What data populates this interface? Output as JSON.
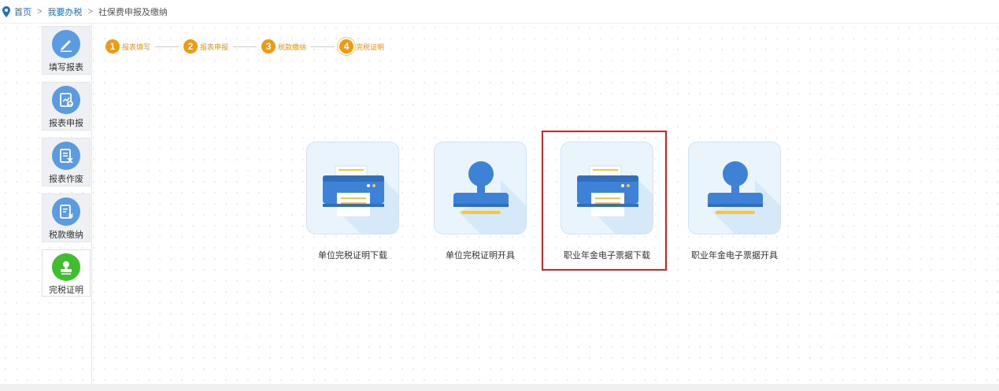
{
  "breadcrumb": {
    "home": "首页",
    "level2": "我要办税",
    "current": "社保费申报及缴纳",
    "separator": ">"
  },
  "sidebar": {
    "items": [
      {
        "label": "填写报表",
        "icon": "pencil-icon"
      },
      {
        "label": "报表申报",
        "icon": "upload-report-icon"
      },
      {
        "label": "报表作废",
        "icon": "void-report-icon"
      },
      {
        "label": "税款缴纳",
        "icon": "tax-payment-icon"
      },
      {
        "label": "完税证明",
        "icon": "stamp-icon"
      }
    ],
    "active_index": 4
  },
  "steps": [
    {
      "num": "1",
      "label": "报表填写"
    },
    {
      "num": "2",
      "label": "报表申报"
    },
    {
      "num": "3",
      "label": "税款缴纳"
    },
    {
      "num": "4",
      "label": "完税证明"
    }
  ],
  "cards": [
    {
      "label": "单位完税证明下载",
      "icon": "printer-icon"
    },
    {
      "label": "单位完税证明开具",
      "icon": "stamp-icon"
    },
    {
      "label": "职业年金电子票据下载",
      "icon": "printer-icon"
    },
    {
      "label": "职业年金电子票据开具",
      "icon": "stamp-icon"
    }
  ],
  "colors": {
    "accent_orange": "#f29a0f",
    "link_blue": "#1f6fc5",
    "icon_blue": "#5b9be0",
    "active_green": "#3fbf2c",
    "highlight_red": "#e02020"
  }
}
